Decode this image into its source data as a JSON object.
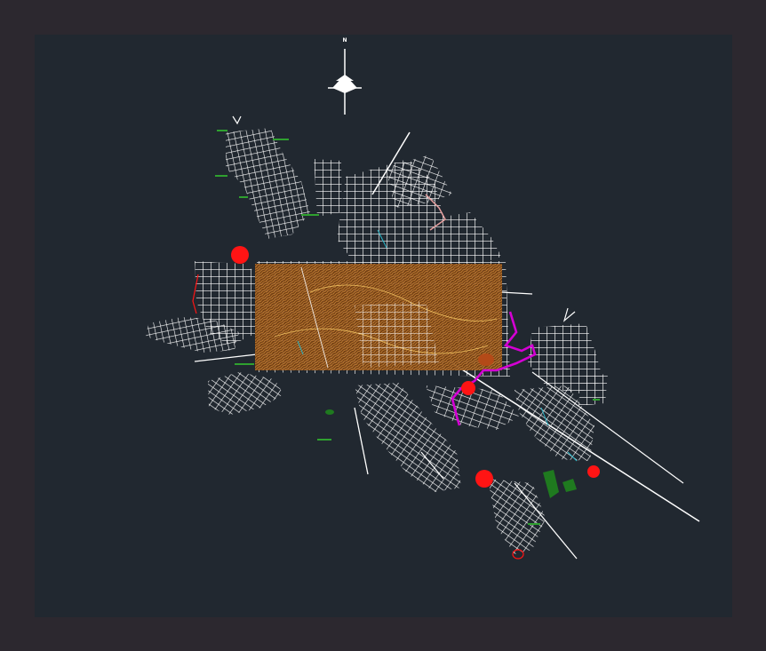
{
  "canvas": {
    "background": "#212830",
    "frame": "#2c282f"
  },
  "north_arrow": {
    "label": "N",
    "icon": "north-arrow-icon",
    "color": "#ffffff"
  },
  "map_colors": {
    "streets": "#ffffff",
    "topography": "#8a4a12",
    "contours": "#c47a2a",
    "markers": "#ff1414",
    "river": "#d400d4",
    "parks": "#1f7a1f",
    "labels": "#2fa12f",
    "accents": "#29b7c9"
  },
  "markers": [
    {
      "name": "marker-northwest",
      "color": "#ff1414"
    },
    {
      "name": "marker-central-east",
      "color": "#ff1414"
    },
    {
      "name": "marker-south",
      "color": "#ff1414"
    },
    {
      "name": "marker-southeast",
      "color": "#ff1414"
    }
  ]
}
